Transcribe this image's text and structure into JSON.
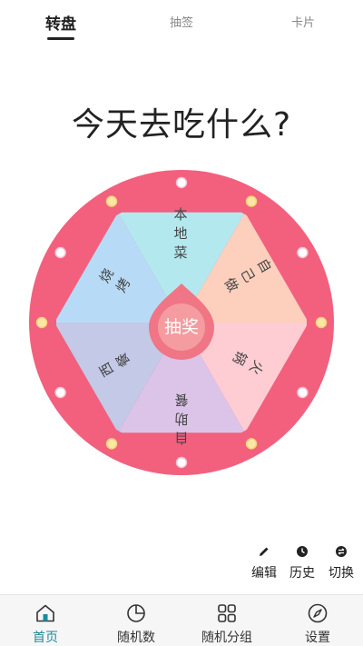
{
  "tabs": [
    {
      "label": "转盘",
      "active": true
    },
    {
      "label": "抽签",
      "active": false
    },
    {
      "label": "卡片",
      "active": false
    }
  ],
  "title": "今天去吃什么?",
  "wheel": {
    "rim_color": "#f2607e",
    "segments": [
      {
        "label": "本地菜",
        "color": "#b3e8ef"
      },
      {
        "label": "自己做",
        "color": "#fdd0bd"
      },
      {
        "label": "火锅",
        "color": "#fdcdd3"
      },
      {
        "label": "自助餐",
        "color": "#dcc3e8"
      },
      {
        "label": "西餐",
        "color": "#c3c9e6"
      },
      {
        "label": "烧烤",
        "color": "#b7dbf6"
      }
    ],
    "center_button": {
      "label": "抽奖",
      "color": "#f07585"
    }
  },
  "tools": [
    {
      "label": "编辑",
      "icon": "pencil-icon"
    },
    {
      "label": "历史",
      "icon": "clock-icon"
    },
    {
      "label": "切换",
      "icon": "switch-icon"
    }
  ],
  "bottom_nav": [
    {
      "label": "首页",
      "icon": "home-icon",
      "active": true
    },
    {
      "label": "随机数",
      "icon": "pie-chart-icon",
      "active": false
    },
    {
      "label": "随机分组",
      "icon": "grid-icon",
      "active": false
    },
    {
      "label": "设置",
      "icon": "compass-icon",
      "active": false
    }
  ],
  "accent_color": "#1d8a9a"
}
